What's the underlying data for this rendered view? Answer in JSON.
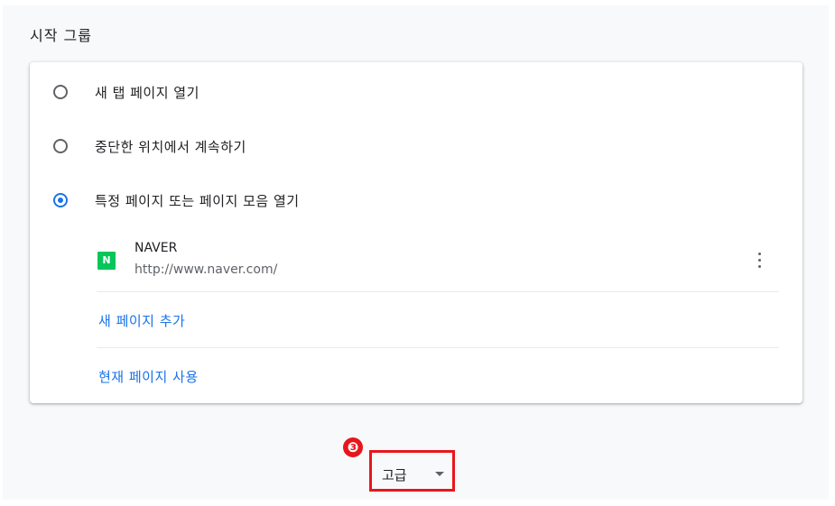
{
  "section": {
    "title": "시작 그룹"
  },
  "startup_options": [
    {
      "label": "새 탭 페이지 열기",
      "checked": false
    },
    {
      "label": "중단한 위치에서 계속하기",
      "checked": false
    },
    {
      "label": "특정 페이지 또는 페이지 모음 열기",
      "checked": true
    }
  ],
  "pages": [
    {
      "name": "NAVER",
      "url": "http://www.naver.com/",
      "favicon_letter": "N",
      "favicon_color": "#03c75a"
    }
  ],
  "links": {
    "add_page": "새 페이지 추가",
    "use_current": "현재 페이지 사용"
  },
  "advanced": {
    "label": "고급",
    "icon": "caret-down-icon"
  },
  "annotation": {
    "step_number": "❸",
    "highlight_color": "#e8161c"
  },
  "colors": {
    "accent": "#1a73e8",
    "background": "#f8f9fa"
  }
}
